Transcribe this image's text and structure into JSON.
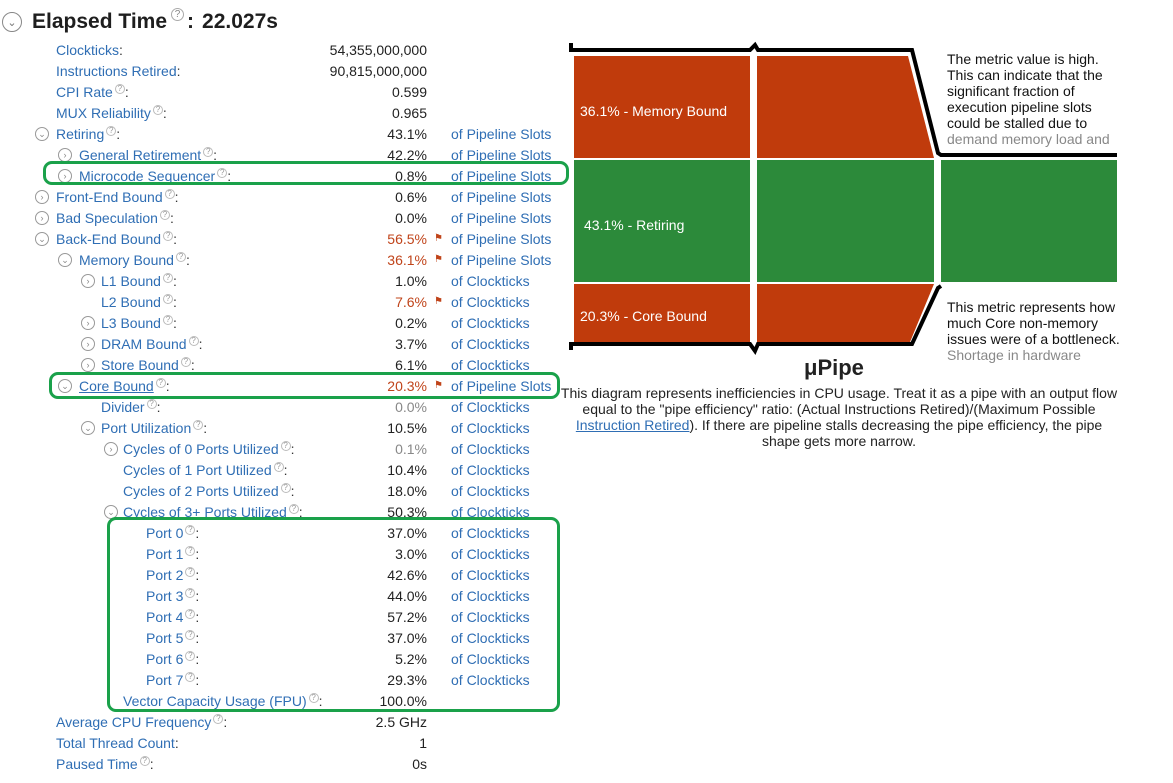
{
  "title": {
    "label": "Elapsed Time",
    "value": "22.027s"
  },
  "metrics": [
    {
      "name": "Clockticks",
      "value": "54,355,000,000",
      "unit": ""
    },
    {
      "name": "Instructions Retired",
      "value": "90,815,000,000",
      "unit": ""
    },
    {
      "name": "CPI Rate",
      "value": "0.599",
      "unit": ""
    },
    {
      "name": "MUX Reliability",
      "value": "0.965",
      "unit": ""
    },
    {
      "name": "Retiring",
      "value": "43.1%",
      "unit": "of Pipeline Slots"
    },
    {
      "name": "General Retirement",
      "value": "42.2%",
      "unit": "of Pipeline Slots"
    },
    {
      "name": "Microcode Sequencer",
      "value": "0.8%",
      "unit": "of Pipeline Slots"
    },
    {
      "name": "Front-End Bound",
      "value": "0.6%",
      "unit": "of Pipeline Slots"
    },
    {
      "name": "Bad Speculation",
      "value": "0.0%",
      "unit": "of Pipeline Slots"
    },
    {
      "name": "Back-End Bound",
      "value": "56.5%",
      "unit": "of Pipeline Slots"
    },
    {
      "name": "Memory Bound",
      "value": "36.1%",
      "unit": "of Pipeline Slots"
    },
    {
      "name": "L1 Bound",
      "value": "1.0%",
      "unit": "of Clockticks"
    },
    {
      "name": "L2 Bound",
      "value": "7.6%",
      "unit": "of Clockticks"
    },
    {
      "name": "L3 Bound",
      "value": "0.2%",
      "unit": "of Clockticks"
    },
    {
      "name": "DRAM Bound",
      "value": "3.7%",
      "unit": "of Clockticks"
    },
    {
      "name": "Store Bound",
      "value": "6.1%",
      "unit": "of Clockticks"
    },
    {
      "name": "Core Bound",
      "value": "20.3%",
      "unit": "of Pipeline Slots"
    },
    {
      "name": "Divider",
      "value": "0.0%",
      "unit": "of Clockticks"
    },
    {
      "name": "Port Utilization",
      "value": "10.5%",
      "unit": "of Clockticks"
    },
    {
      "name": "Cycles of 0 Ports Utilized",
      "value": "0.1%",
      "unit": "of Clockticks"
    },
    {
      "name": "Cycles of 1 Port Utilized",
      "value": "10.4%",
      "unit": "of Clockticks"
    },
    {
      "name": "Cycles of 2 Ports Utilized",
      "value": "18.0%",
      "unit": "of Clockticks"
    },
    {
      "name": "Cycles of 3+ Ports Utilized",
      "value": "50.3%",
      "unit": "of Clockticks"
    },
    {
      "name": "Port 0",
      "value": "37.0%",
      "unit": "of Clockticks"
    },
    {
      "name": "Port 1",
      "value": "3.0%",
      "unit": "of Clockticks"
    },
    {
      "name": "Port 2",
      "value": "42.6%",
      "unit": "of Clockticks"
    },
    {
      "name": "Port 3",
      "value": "44.0%",
      "unit": "of Clockticks"
    },
    {
      "name": "Port 4",
      "value": "57.2%",
      "unit": "of Clockticks"
    },
    {
      "name": "Port 5",
      "value": "37.0%",
      "unit": "of Clockticks"
    },
    {
      "name": "Port 6",
      "value": "5.2%",
      "unit": "of Clockticks"
    },
    {
      "name": "Port 7",
      "value": "29.3%",
      "unit": "of Clockticks"
    },
    {
      "name": "Vector Capacity Usage (FPU)",
      "value": "100.0%",
      "unit": ""
    },
    {
      "name": "Average CPU Frequency",
      "value": "2.5 GHz",
      "unit": ""
    },
    {
      "name": "Total Thread Count",
      "value": "1",
      "unit": ""
    },
    {
      "name": "Paused Time",
      "value": "0s",
      "unit": ""
    }
  ],
  "pipe": {
    "memory_label": "36.1% - Memory Bound",
    "retiring_label": "43.1% - Retiring",
    "core_label": "20.3% - Core Bound",
    "note_top": "The metric value is high. This can indicate that the significant fraction of execution pipeline slots could be stalled due to",
    "note_top_fade": "demand memory load and",
    "note_bottom": "This metric represents how much Core non-memory issues were of a bottleneck.",
    "note_bottom_fade": "Shortage in hardware",
    "colors": {
      "bound": "#c03b0c",
      "retiring": "#2c8a3a"
    }
  },
  "upipe_title": "μPipe",
  "description": {
    "before": "This diagram represents inefficiencies in CPU usage. Treat it as a pipe with an output flow equal to the \"pipe efficiency\" ratio: (Actual Instructions Retired)/(Maximum Possible ",
    "link": "Instruction Retired",
    "after": "). If there are pipeline stalls decreasing the pipe efficiency, the pipe shape gets more narrow."
  }
}
